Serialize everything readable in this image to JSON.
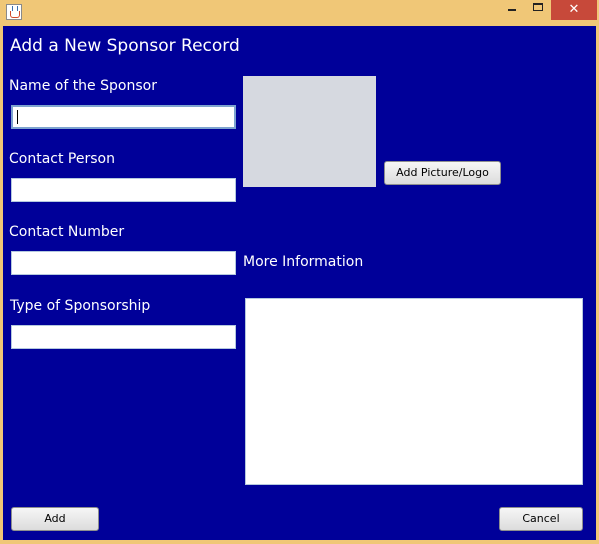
{
  "window": {
    "icon": "java-icon",
    "close_glyph": "✕"
  },
  "form": {
    "heading": "Add a New Sponsor Record",
    "sponsor_name_label": "Name of the Sponsor",
    "sponsor_name_value": "",
    "contact_person_label": "Contact Person",
    "contact_person_value": "",
    "contact_number_label": "Contact Number",
    "contact_number_value": "",
    "sponsorship_type_label": "Type of Sponsorship",
    "sponsorship_type_value": "",
    "more_info_label": "More Information",
    "more_info_value": "",
    "add_picture_label": "Add Picture/Logo"
  },
  "buttons": {
    "add_label": "Add",
    "cancel_label": "Cancel"
  },
  "colors": {
    "background": "#000099",
    "titlebar": "#f0c777",
    "close": "#c7493a"
  }
}
